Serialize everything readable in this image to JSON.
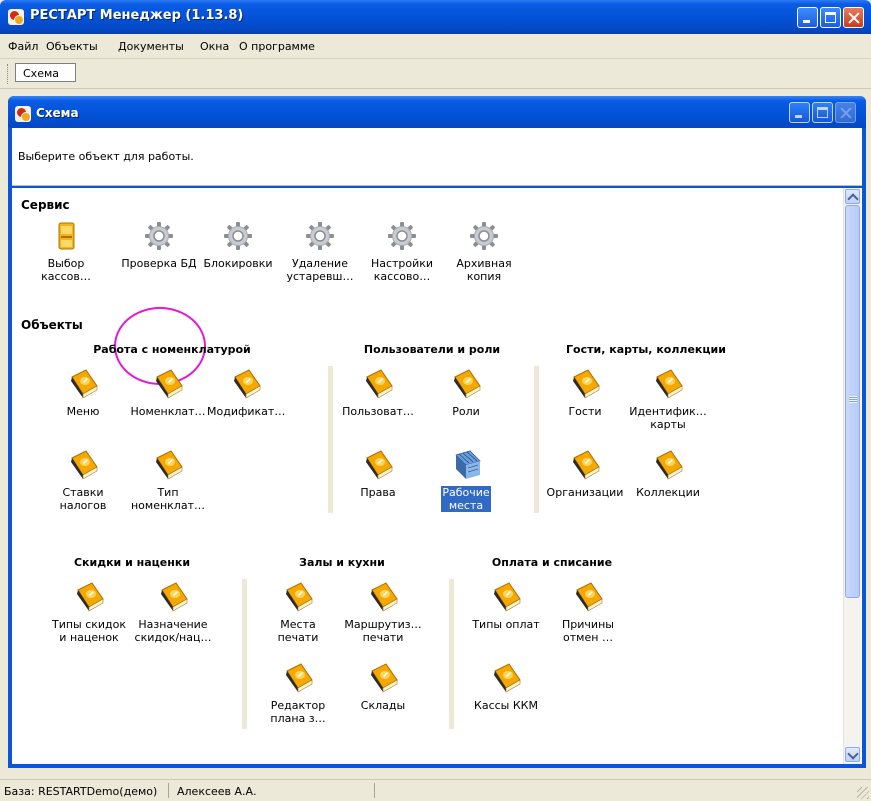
{
  "window": {
    "title": "РЕСТАРТ Менеджер (1.13.8)"
  },
  "menu": [
    "Файл",
    "Объекты",
    "Документы",
    "Окна",
    "О программе"
  ],
  "toolbar": {
    "tab_label": "Схема"
  },
  "child_window": {
    "title": "Схема",
    "hint": "Выберите объект для работы."
  },
  "service": {
    "title": "Сервис",
    "items": [
      {
        "label": "Выбор\nкассов…",
        "icon": "cash-register-icon"
      },
      {
        "label": "Проверка БД",
        "icon": "gear-icon"
      },
      {
        "label": "Блокировки",
        "icon": "gear-icon"
      },
      {
        "label": "Удаление\nустаревш…",
        "icon": "gear-icon"
      },
      {
        "label": "Настройки\nкассово…",
        "icon": "gear-icon"
      },
      {
        "label": "Архивная\nкопия",
        "icon": "gear-icon"
      }
    ]
  },
  "objects": {
    "title": "Объекты",
    "groups": [
      {
        "title": "Работа с номенклатурой",
        "items": [
          {
            "label": "Меню",
            "icon": "book-icon"
          },
          {
            "label": "Номенклат…",
            "icon": "book-icon"
          },
          {
            "label": "Модификат…",
            "icon": "book-icon"
          },
          {
            "label": "Ставки\nналогов",
            "icon": "book-icon"
          },
          {
            "label": "Тип\nноменклат…",
            "icon": "book-icon"
          }
        ]
      },
      {
        "title": "Пользователи и роли",
        "items": [
          {
            "label": "Пользоват…",
            "icon": "book-icon"
          },
          {
            "label": "Роли",
            "icon": "book-icon"
          },
          {
            "label": "Права",
            "icon": "book-icon"
          },
          {
            "label": "Рабочие\nместа",
            "icon": "workstation-icon",
            "selected": true
          }
        ]
      },
      {
        "title": "Гости, карты, коллекции",
        "items": [
          {
            "label": "Гости",
            "icon": "book-icon"
          },
          {
            "label": "Идентифик…\nкарты",
            "icon": "book-icon"
          },
          {
            "label": "Организации",
            "icon": "book-icon"
          },
          {
            "label": "Коллекции",
            "icon": "book-icon"
          }
        ]
      },
      {
        "title": "Скидки и наценки",
        "items": [
          {
            "label": "Типы скидок\nи наценок",
            "icon": "book-icon"
          },
          {
            "label": "Назначение\nскидок/нац…",
            "icon": "book-icon"
          }
        ]
      },
      {
        "title": "Залы и кухни",
        "items": [
          {
            "label": "Места печати",
            "icon": "book-icon"
          },
          {
            "label": "Маршрутиз…\nпечати",
            "icon": "book-icon"
          },
          {
            "label": "Редактор\nплана з…",
            "icon": "book-icon"
          },
          {
            "label": "Склады",
            "icon": "book-icon"
          }
        ]
      },
      {
        "title": "Оплата и списание",
        "items": [
          {
            "label": "Типы оплат",
            "icon": "book-icon"
          },
          {
            "label": "Причины\nотмен …",
            "icon": "book-icon"
          },
          {
            "label": "Кассы ККМ",
            "icon": "book-icon"
          }
        ]
      }
    ]
  },
  "status": {
    "db": "База: RESTARTDemo(демо)",
    "user": "Алексеев А.А."
  },
  "colors": {
    "title_blue": "#0453d8",
    "selection": "#316ac5",
    "highlight_ring": "#e21ad8",
    "book_cover": "#f5a800"
  }
}
